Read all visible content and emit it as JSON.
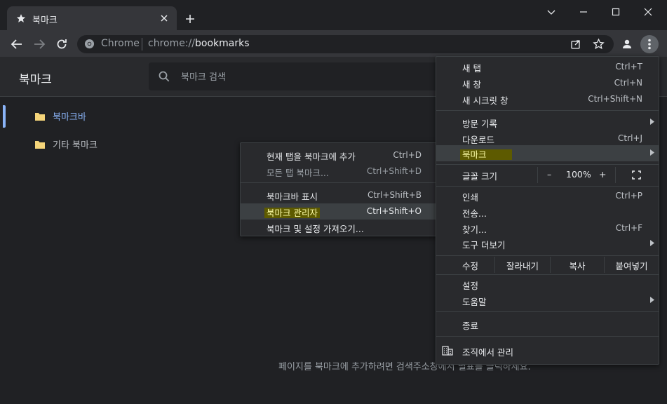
{
  "browser": {
    "tab_title": "북마크",
    "new_tab_glyph": "+",
    "omnibox_chip": "Chrome",
    "url_scheme": "chrome://",
    "url_host": "bookmarks"
  },
  "page": {
    "title": "북마크",
    "search_placeholder": "북마크 검색",
    "tree": [
      {
        "label": "북마크바",
        "active": true
      },
      {
        "label": "기타 북마크",
        "active": false
      }
    ],
    "empty_message": "페이지를 북마크에 추가하려면 검색주소창에서 별표를 클릭하세요."
  },
  "main_menu": {
    "new_tab": {
      "label": "새 탭",
      "shortcut": "Ctrl+T"
    },
    "new_window": {
      "label": "새 창",
      "shortcut": "Ctrl+N"
    },
    "incognito": {
      "label": "새 시크릿 창",
      "shortcut": "Ctrl+Shift+N"
    },
    "history": {
      "label": "방문 기록"
    },
    "downloads": {
      "label": "다운로드",
      "shortcut": "Ctrl+J"
    },
    "bookmarks": {
      "label": "북마크"
    },
    "zoom": {
      "label": "글꼴 크기",
      "minus": "–",
      "value": "100%",
      "plus": "+"
    },
    "print": {
      "label": "인쇄",
      "shortcut": "Ctrl+P"
    },
    "cast": {
      "label": "전송..."
    },
    "find": {
      "label": "찾기...",
      "shortcut": "Ctrl+F"
    },
    "more_tools": {
      "label": "도구 더보기"
    },
    "edit": {
      "label": "수정",
      "cut": "잘라내기",
      "copy": "복사",
      "paste": "붙여넣기"
    },
    "settings": {
      "label": "설정"
    },
    "help": {
      "label": "도움말"
    },
    "exit": {
      "label": "종료"
    },
    "managed": {
      "label": "조직에서 관리"
    }
  },
  "bookmark_submenu": {
    "add_current": {
      "label": "현재 탭을 북마크에 추가",
      "shortcut": "Ctrl+D"
    },
    "add_all": {
      "label": "모든 탭 북마크...",
      "shortcut": "Ctrl+Shift+D"
    },
    "show_bar": {
      "label": "북마크바 표시",
      "shortcut": "Ctrl+Shift+B"
    },
    "manager": {
      "label": "북마크 관리자",
      "shortcut": "Ctrl+Shift+O"
    },
    "import": {
      "label": "북마크 및 설정 가져오기..."
    }
  },
  "colors": {
    "background": "#202124",
    "toolbar": "#35363a",
    "menu": "#292a2d",
    "accent": "#8ab4f8",
    "folder": "#f5d57a",
    "highlight": "#5d5a00"
  }
}
